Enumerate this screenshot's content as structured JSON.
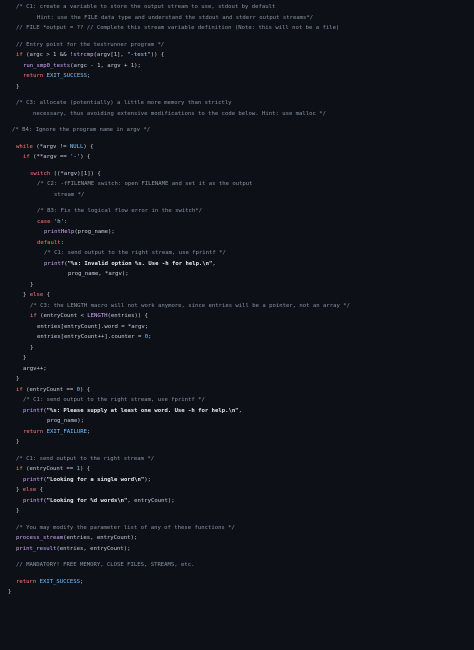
{
  "code": {
    "l1": "/* C1: create a variable to store the output stream to use, stdout by default",
    "l2": "Hint: use the FILE data type and understand the stdout and stderr output streams*/",
    "l3": "// FILE *output = ?? // Complete this stream variable definition (Note: this will not be a file)",
    "l4": "// Entry point for the testrunner program */",
    "l5a": "if",
    "l5b": " (argc > 1 && ",
    "l5c": "!strcmp",
    "l5d": "(argv[1], ",
    "l5e": "\"-test\"",
    "l5f": ")) {",
    "l6a": "run_smp0_tests",
    "l6b": "(argc - 1, argv + 1);",
    "l7a": "return",
    "l7b": " EXIT_SUCCESS",
    "l7c": ";",
    "l8": "}",
    "l9": "/* C3: allocate (potentially) a little more memory than strictly",
    "l10": "necessary, thus avoiding extensive modifications to the code below. Hint: use malloc */",
    "l11": "/* B4: Ignore the program name in argv */",
    "l12a": "while",
    "l12b": " (*argv != ",
    "l12c": "NULL",
    "l12d": ") {",
    "l13a": "if",
    "l13b": " (**argv == ",
    "l13c": "'-'",
    "l13d": ") {",
    "l14a": "switch",
    "l14b": " ((*argv)[1]) {",
    "l15": "/* C2: -fFILENAME switch: open FILENAME and set it as the output",
    "l16": "stream */",
    "l17": "/* B3: Fix the logical flow error in the switch*/",
    "l18a": "case",
    "l18b": " ",
    "l18c": "'h'",
    "l18d": ":",
    "l19a": "printHelp",
    "l19b": "(prog_name);",
    "l20a": "default",
    "l20b": ":",
    "l21": "/* C1: send output to the right stream, use fprintf */",
    "l22a": "printf",
    "l22b": "(",
    "l22c": "\"%s: Invalid option %s. Use -h for help.\\n\"",
    "l22d": ",",
    "l23": "prog_name, *argv);",
    "l24": "}",
    "l25a": "} ",
    "l25b": "else",
    "l25c": " {",
    "l26": "/* C3: the LENGTH macro will not work anymore, since entries will be a pointer, not an array */",
    "l27a": "if",
    "l27b": " (entryCount < ",
    "l27c": "LENGTH",
    "l27d": "(entries)) {",
    "l28": "entries[entryCount].word = *argv;",
    "l29a": "entries[entryCount++].counter = ",
    "l29b": "0",
    "l29c": ";",
    "l30": "}",
    "l31": "}",
    "l32": "argv++;",
    "l33": "}",
    "l34a": "if",
    "l34b": " (entryCount == ",
    "l34c": "0",
    "l34d": ") {",
    "l35": "/* C1: send output to the right stream, use fprintf */",
    "l36a": "printf",
    "l36b": "(",
    "l36c": "\"%s: Please supply at least one word. Use -h for help.\\n\"",
    "l36d": ",",
    "l37": "prog_name);",
    "l38a": "return",
    "l38b": " EXIT_FAILURE",
    "l38c": ";",
    "l39": "}",
    "l40": "/* C1: send output to the right stream */",
    "l41a": "if",
    "l41b": " (entryCount == ",
    "l41c": "1",
    "l41d": ") {",
    "l42a": "printf",
    "l42b": "(",
    "l42c": "\"Looking for a single word\\n\"",
    "l42d": ");",
    "l43a": "} ",
    "l43b": "else",
    "l43c": " {",
    "l44a": "printf",
    "l44b": "(",
    "l44c": "\"Looking for %d words\\n\"",
    "l44d": ", entryCount);",
    "l45": "}",
    "l46": "/* You may modify the parameter list of any of these functions */",
    "l47a": "process_stream",
    "l47b": "(entries, entryCount);",
    "l48a": "print_result",
    "l48b": "(entries, entryCount);",
    "l49": "// MANDATORY! FREE MEMORY, CLOSE FILES, STREAMS, etc.",
    "l50a": "return",
    "l50b": " EXIT_SUCCESS",
    "l50c": ";",
    "l51": "}"
  },
  "colors": {
    "background": "#0d1117",
    "comment": "#8b949e",
    "keyword": "#ff7b72",
    "function": "#d2a8ff",
    "constant": "#79c0ff",
    "string": "#a5d6ff",
    "text": "#c9d1d9"
  }
}
